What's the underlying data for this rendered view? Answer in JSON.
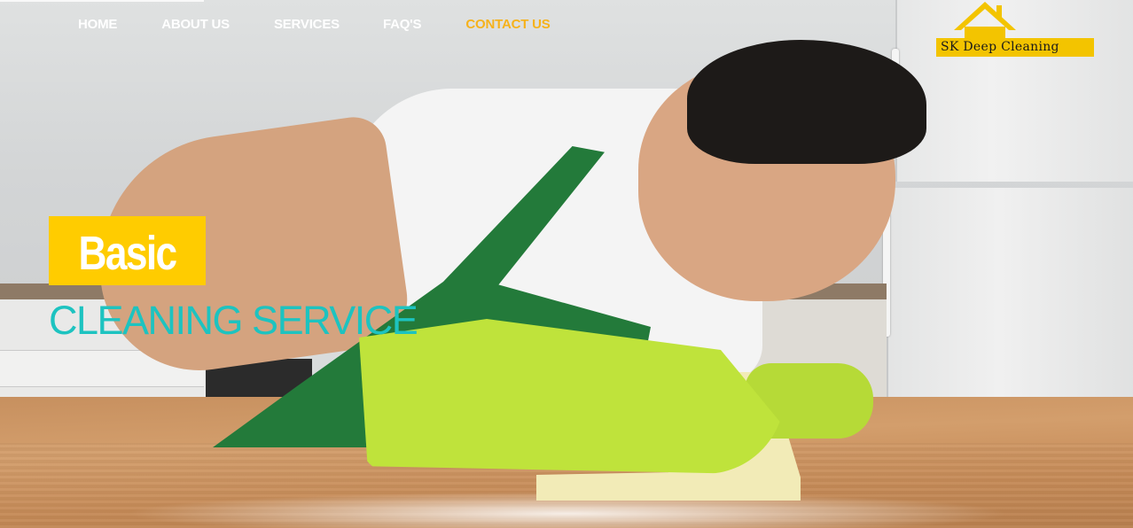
{
  "nav": {
    "items": [
      {
        "label": "HOME"
      },
      {
        "label": "ABOUT US"
      },
      {
        "label": "SERVICES"
      },
      {
        "label": "FAQ'S"
      },
      {
        "label": "CONTACT US"
      }
    ],
    "active_color": "#f6b21b"
  },
  "logo": {
    "text": "SK Deep Cleaning",
    "bar_color": "#f3c400",
    "icon": "house-icon"
  },
  "hero": {
    "badge_text": "Basic",
    "badge_color": "#ffcc00",
    "subtitle": "CLEANING SERVICE",
    "subtitle_color": "#1dc3c0"
  }
}
